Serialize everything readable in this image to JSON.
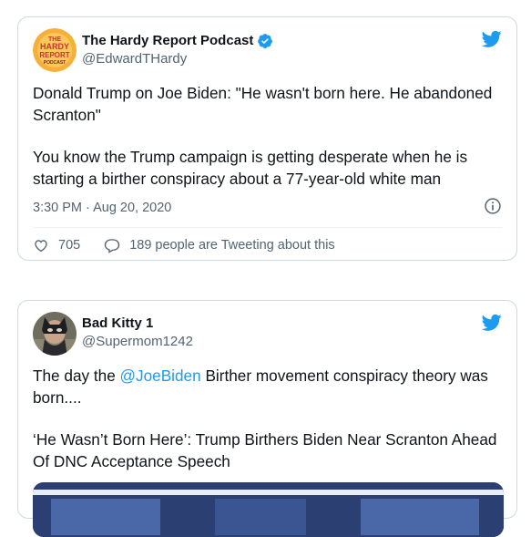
{
  "tweet1": {
    "display_name": "The Hardy Report Podcast",
    "handle": "@EdwardTHardy",
    "avatar_text": [
      "THE",
      "HARDY",
      "REPORT",
      "PODCAST"
    ],
    "paragraph1": "Donald Trump on Joe Biden: \"He wasn't born here. He abandoned Scranton\"",
    "paragraph2": "You know the Trump campaign is getting desperate when he is starting a birther conspiracy about a 77-year-old white man",
    "timestamp": "3:30 PM · Aug 20, 2020",
    "likes": "705",
    "retweets_text": "189 people are Tweeting about this"
  },
  "tweet2": {
    "display_name": "Bad Kitty 1",
    "handle": "@Supermom1242",
    "text_before": "The day the ",
    "mention": "@JoeBiden",
    "text_after": " Birther movement conspiracy theory was born....",
    "link_title": "‘He Wasn’t Born Here’: Trump Birthers Biden Near Scranton Ahead Of DNC Acceptance Speech"
  },
  "colors": {
    "accent": "#1d9bf0",
    "verified": "#1d9bf0",
    "secondary_text": "#536471",
    "border": "#cfd9de"
  },
  "icons": [
    "twitter-bird-icon",
    "verified-badge-icon",
    "info-icon",
    "heart-icon",
    "speech-bubble-icon"
  ]
}
